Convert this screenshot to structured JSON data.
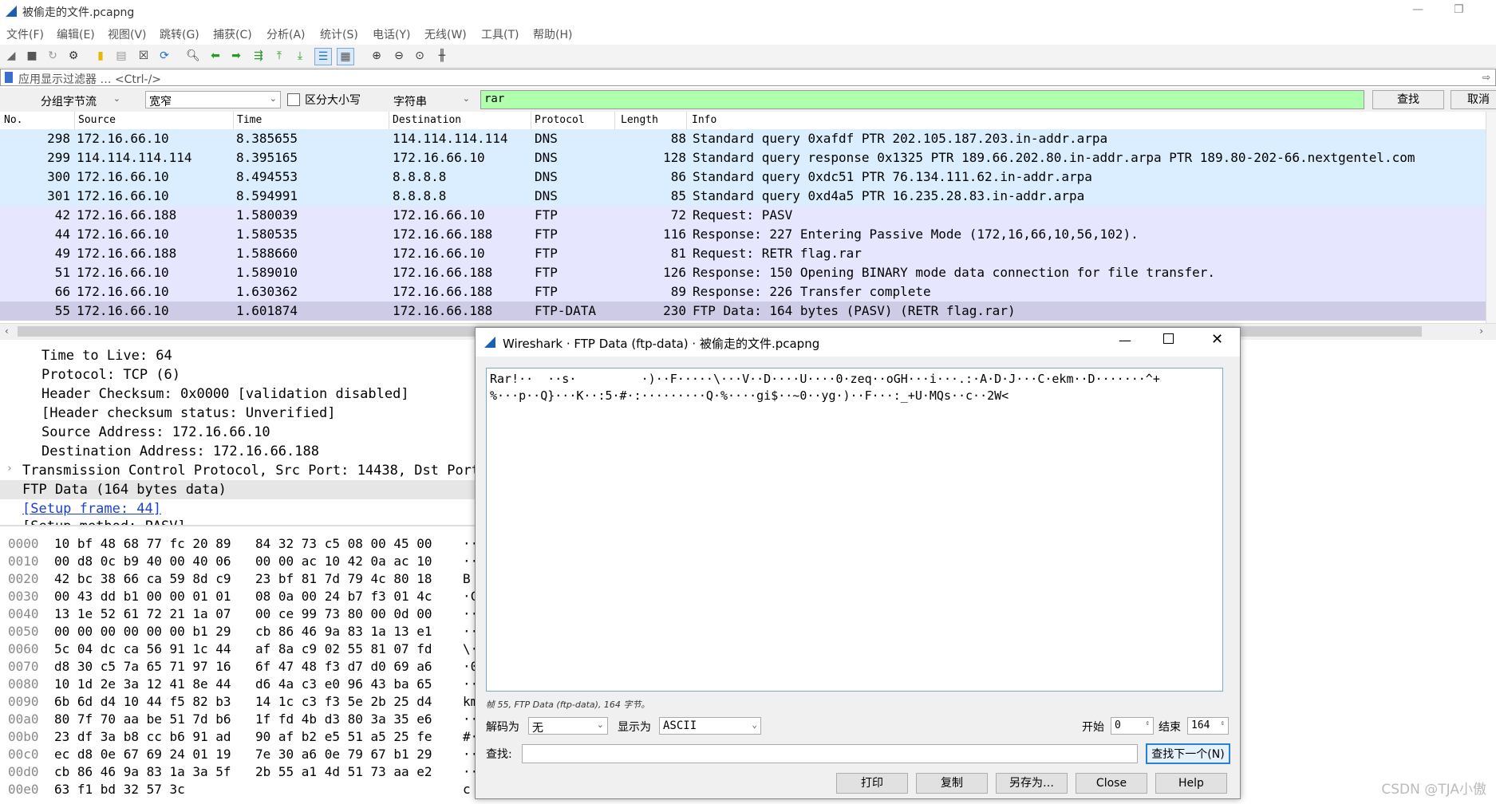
{
  "window": {
    "title": "被偷走的文件.pcapng"
  },
  "menu": [
    "文件(F)",
    "编辑(E)",
    "视图(V)",
    "跳转(G)",
    "捕获(C)",
    "分析(A)",
    "统计(S)",
    "电话(Y)",
    "无线(W)",
    "工具(T)",
    "帮助(H)"
  ],
  "filter": {
    "placeholder": "应用显示过滤器 … <Ctrl-/>"
  },
  "find": {
    "search_in": "分组字节流",
    "char_width": "宽窄",
    "case_label": "区分大小写",
    "search_type": "字符串",
    "query": "rar",
    "find_label": "查找",
    "cancel_label": "取消"
  },
  "packet_list": {
    "columns": [
      "No.",
      "Source",
      "Time",
      "Destination",
      "Protocol",
      "Length",
      "Info"
    ],
    "rows": [
      {
        "no": "298",
        "src": "172.16.66.10",
        "time": "8.385655",
        "dst": "114.114.114.114",
        "proto": "DNS",
        "len": "88",
        "info": "Standard query 0xafdf PTR 202.105.187.203.in-addr.arpa",
        "bg": "#daeeff"
      },
      {
        "no": "299",
        "src": "114.114.114.114",
        "time": "8.395165",
        "dst": "172.16.66.10",
        "proto": "DNS",
        "len": "128",
        "info": "Standard query response 0x1325 PTR 189.66.202.80.in-addr.arpa PTR 189.80-202-66.nextgentel.com",
        "bg": "#daeeff"
      },
      {
        "no": "300",
        "src": "172.16.66.10",
        "time": "8.494553",
        "dst": "8.8.8.8",
        "proto": "DNS",
        "len": "86",
        "info": "Standard query 0xdc51 PTR 76.134.111.62.in-addr.arpa",
        "bg": "#daeeff"
      },
      {
        "no": "301",
        "src": "172.16.66.10",
        "time": "8.594991",
        "dst": "8.8.8.8",
        "proto": "DNS",
        "len": "85",
        "info": "Standard query 0xd4a5 PTR 16.235.28.83.in-addr.arpa",
        "bg": "#daeeff"
      },
      {
        "no": "42",
        "src": "172.16.66.188",
        "time": "1.580039",
        "dst": "172.16.66.10",
        "proto": "FTP",
        "len": "72",
        "info": "Request: PASV",
        "bg": "#e7e6ff"
      },
      {
        "no": "44",
        "src": "172.16.66.10",
        "time": "1.580535",
        "dst": "172.16.66.188",
        "proto": "FTP",
        "len": "116",
        "info": "Response: 227 Entering Passive Mode (172,16,66,10,56,102).",
        "bg": "#e7e6ff"
      },
      {
        "no": "49",
        "src": "172.16.66.188",
        "time": "1.588660",
        "dst": "172.16.66.10",
        "proto": "FTP",
        "len": "81",
        "info": "Request: RETR flag.rar",
        "bg": "#e7e6ff"
      },
      {
        "no": "51",
        "src": "172.16.66.10",
        "time": "1.589010",
        "dst": "172.16.66.188",
        "proto": "FTP",
        "len": "126",
        "info": "Response: 150 Opening BINARY mode data connection for file transfer.",
        "bg": "#e7e6ff"
      },
      {
        "no": "66",
        "src": "172.16.66.10",
        "time": "1.630362",
        "dst": "172.16.66.188",
        "proto": "FTP",
        "len": "89",
        "info": "Response: 226 Transfer complete",
        "bg": "#e7e6ff"
      },
      {
        "no": "55",
        "src": "172.16.66.10",
        "time": "1.601874",
        "dst": "172.16.66.188",
        "proto": "FTP-DATA",
        "len": "230",
        "info": "FTP Data: 164 bytes (PASV) (RETR flag.rar)",
        "bg": "#cdcbe6"
      }
    ]
  },
  "details": {
    "lines": [
      "Time to Live: 64",
      "Protocol: TCP (6)",
      "Header Checksum: 0x0000 [validation disabled]",
      "[Header checksum status: Unverified]",
      "Source Address: 172.16.66.10",
      "Destination Address: 172.16.66.188"
    ],
    "tcp_line": "Transmission Control Protocol, Src Port: 14438, Dst Port:",
    "ftp_line": "FTP Data (164 bytes data)",
    "setup_link": "[Setup frame: 44]",
    "cut_line": "[Setup method: PASV]"
  },
  "bytes": {
    "rows": [
      {
        "off": "0000",
        "a": "10 bf 48 68 77 fc 20 89",
        "b": "84 32 73 c5 08 00 45 00",
        "c": "··"
      },
      {
        "off": "0010",
        "a": "00 d8 0c b9 40 00 40 06",
        "b": "00 00 ac 10 42 0a ac 10",
        "c": "··"
      },
      {
        "off": "0020",
        "a": "42 bc 38 66 ca 59 8d c9",
        "b": "23 bf 81 7d 79 4c 80 18",
        "c": "B"
      },
      {
        "off": "0030",
        "a": "00 43 dd b1 00 00 01 01",
        "b": "08 0a 00 24 b7 f3 01 4c",
        "c": "·C"
      },
      {
        "off": "0040",
        "a": "13 1e 52 61 72 21 1a 07",
        "b": "00 ce 99 73 80 00 0d 00",
        "c": "··"
      },
      {
        "off": "0050",
        "a": "00 00 00 00 00 00 b1 29",
        "b": "cb 86 46 9a 83 1a 13 e1",
        "c": "··"
      },
      {
        "off": "0060",
        "a": "5c 04 dc ca 56 91 1c 44",
        "b": "af 8a c9 02 55 81 07 fd",
        "c": "\\·"
      },
      {
        "off": "0070",
        "a": "d8 30 c5 7a 65 71 97 16",
        "b": "6f 47 48 f3 d7 d0 69 a6",
        "c": "·0"
      },
      {
        "off": "0080",
        "a": "10 1d 2e 3a 12 41 8e 44",
        "b": "d6 4a c3 e0 96 43 ba 65",
        "c": "··"
      },
      {
        "off": "0090",
        "a": "6b 6d d4 10 44 f5 82 b3",
        "b": "14 1c c3 f3 5e 2b 25 d4",
        "c": "km"
      },
      {
        "off": "00a0",
        "a": "80 7f 70 aa be 51 7d b6",
        "b": "1f fd 4b d3 80 3a 35 e6",
        "c": "··"
      },
      {
        "off": "00b0",
        "a": "23 df 3a b8 cc b6 91 ad",
        "b": "90 af b2 e5 51 a5 25 fe",
        "c": "#·"
      },
      {
        "off": "00c0",
        "a": "ec d8 0e 67 69 24 01 19",
        "b": "7e 30 a6 0e 79 67 b1 29",
        "c": "··"
      },
      {
        "off": "00d0",
        "a": "cb 86 46 9a 83 1a 3a 5f",
        "b": "2b 55 a1 4d 51 73 aa e2",
        "c": "··"
      },
      {
        "off": "00e0",
        "a": "63 f1 bd 32 57 3c",
        "b": "",
        "c": "c"
      }
    ]
  },
  "dialog": {
    "title": "Wireshark · FTP Data (ftp-data) · 被偷走的文件.pcapng",
    "content_line1": "Rar!··  ··s·         ·)··F·····\\···V··D····U····0·zeq··oGH···i···.:·A·D·J···C·ekm··D·······^+",
    "content_line2": "%···p··Q}···K··:5·#·:·········Q·%····gi$··~0··yg·)··F···:_+U·MQs··c··2W<",
    "status": "帧 55, FTP Data (ftp-data), 164 字节。",
    "decode_label": "解码为",
    "decode_value": "无",
    "show_label": "显示为",
    "show_value": "ASCII",
    "start_label": "开始",
    "start_value": "0",
    "end_label": "结束",
    "end_value": "164",
    "find_label": "查找:",
    "find_next": "查找下一个(N)",
    "buttons": [
      "打印",
      "复制",
      "另存为…",
      "Close",
      "Help"
    ]
  },
  "watermark": "CSDN @TJA小傲",
  "colors": {
    "dns_row": "#daeeff",
    "ftp_row": "#e7e6ff",
    "selected_row": "#cdcbe6",
    "filter_ok": "#afffaf",
    "link": "#1a3fd4"
  }
}
